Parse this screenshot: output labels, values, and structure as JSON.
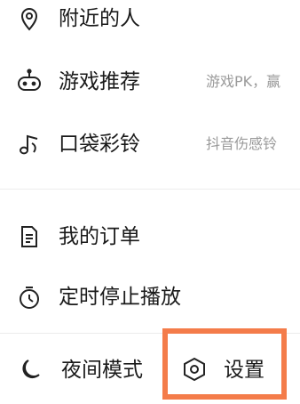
{
  "menu": {
    "nearby": {
      "label": "附近的人",
      "icon": "location-pin-icon"
    },
    "games": {
      "label": "游戏推荐",
      "subtitle": "游戏PK，赢",
      "icon": "gamepad-icon"
    },
    "ringtones": {
      "label": "口袋彩铃",
      "subtitle": "抖音伤感铃",
      "icon": "music-note-icon"
    },
    "orders": {
      "label": "我的订单",
      "icon": "document-icon"
    },
    "timer": {
      "label": "定时停止播放",
      "icon": "timer-icon"
    }
  },
  "bottom_bar": {
    "night_mode": {
      "label": "夜间模式",
      "icon": "moon-icon"
    },
    "settings": {
      "label": "设置",
      "icon": "hexagon-gear-icon"
    }
  },
  "colors": {
    "highlight": "#f47c4a",
    "text": "#1a1a1a",
    "subtext": "#9a9a9a",
    "divider": "#ececec"
  }
}
